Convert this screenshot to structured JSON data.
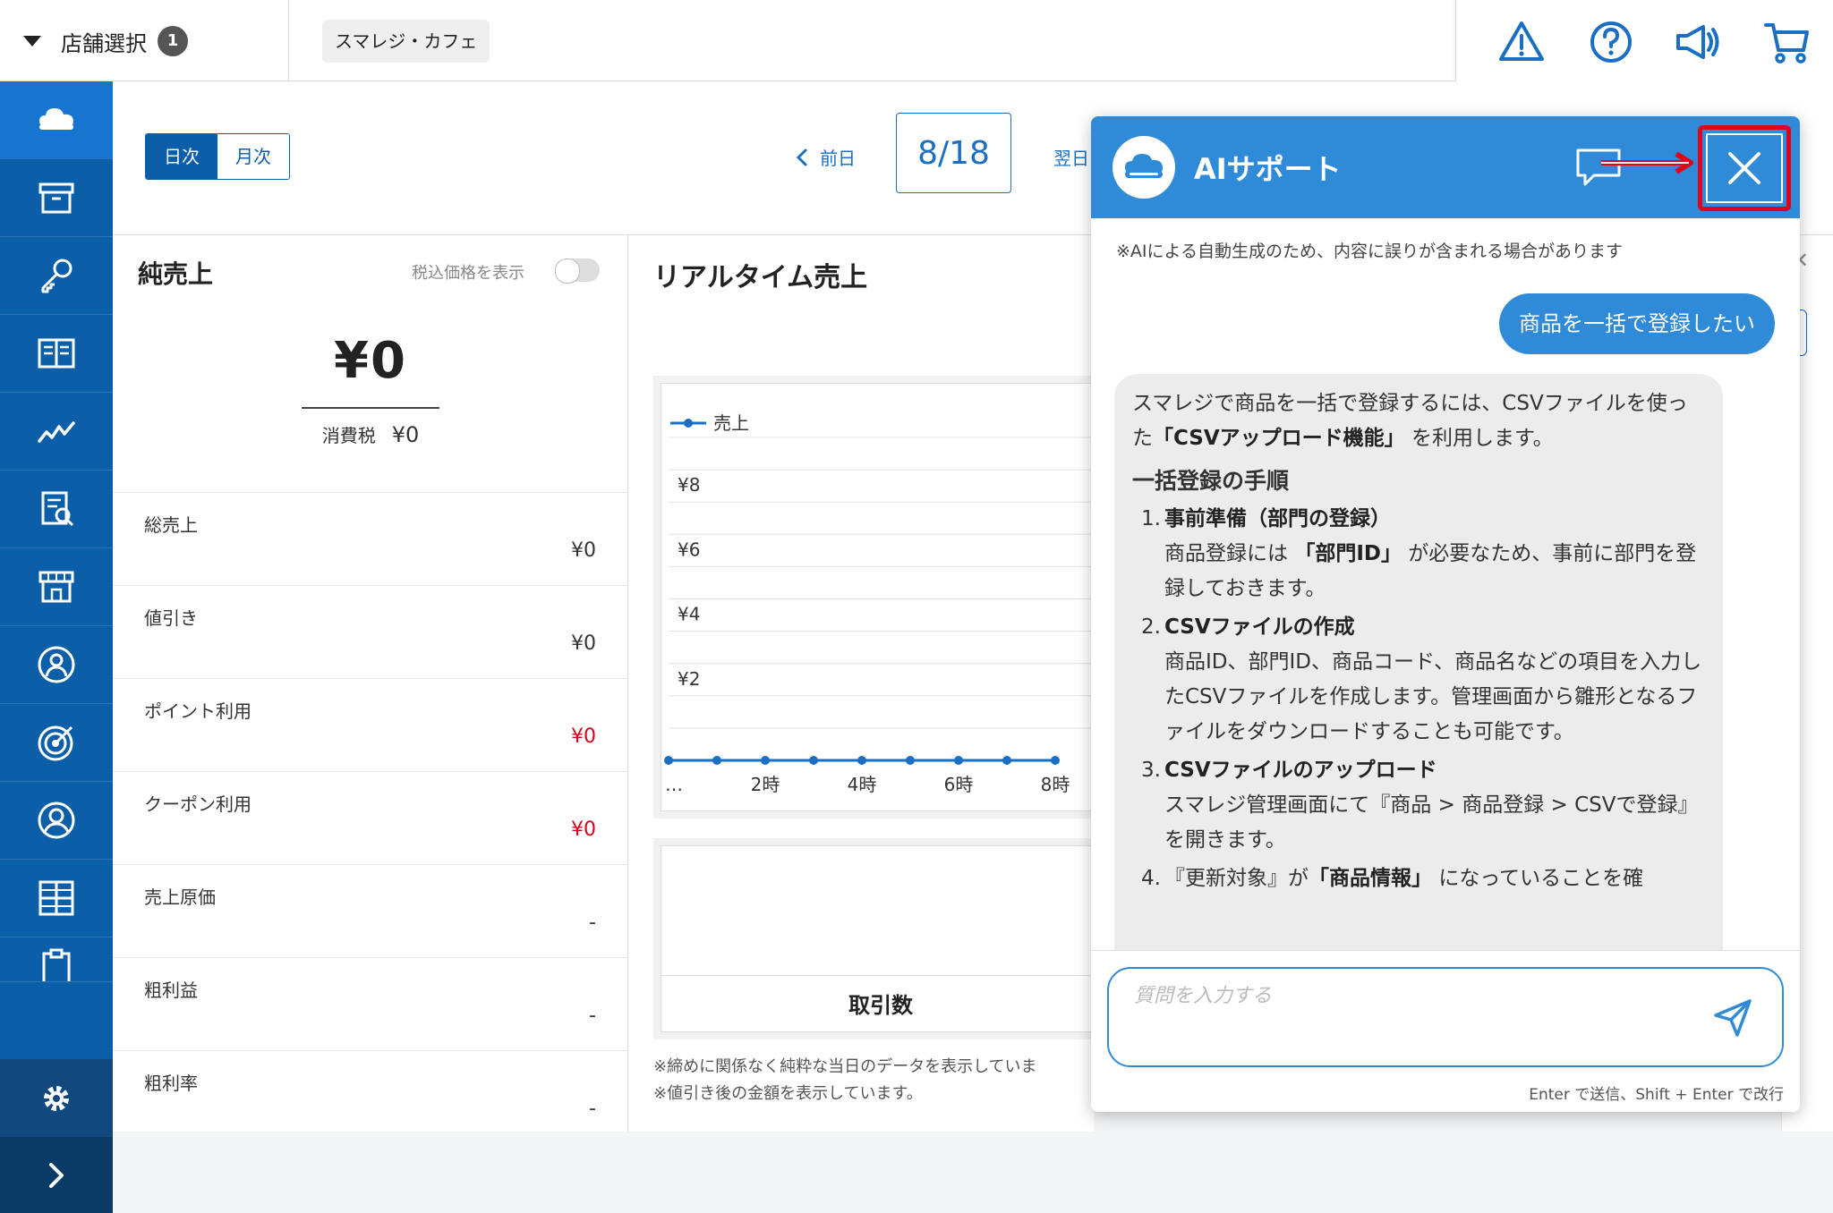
{
  "topbar": {
    "store_select_label": "店舗選択",
    "store_count": "1",
    "shop_name": "スマレジ・カフェ",
    "icons": [
      "warning-icon",
      "help-icon",
      "megaphone-icon",
      "cart-icon"
    ]
  },
  "sidebar": {
    "items": [
      "cloud-icon",
      "archive-icon",
      "key-icon",
      "book-icon",
      "trend-icon",
      "report-icon",
      "store-icon",
      "person-badge-icon",
      "target-icon",
      "user-icon",
      "grid-icon",
      "clipboard-icon"
    ],
    "bottom": [
      "gear-icon",
      "chevron-right-icon"
    ]
  },
  "header": {
    "tab_daily": "日次",
    "tab_monthly": "月次",
    "prev_label": "前日",
    "date": "8/18",
    "next_label": "翌日"
  },
  "net_sales": {
    "title": "純売上",
    "tax_toggle_label": "税込価格を表示",
    "amount": "¥0",
    "tax_label": "消費税",
    "tax_value": "¥0",
    "metrics": [
      {
        "label": "総売上",
        "value": "¥0"
      },
      {
        "label": "値引き",
        "value": "¥0"
      },
      {
        "label": "ポイント利用",
        "value": "¥0"
      },
      {
        "label": "クーポン利用",
        "value": "¥0"
      },
      {
        "label": "売上原価",
        "value": "-"
      },
      {
        "label": "粗利益",
        "value": "-"
      },
      {
        "label": "粗利率",
        "value": "-"
      }
    ]
  },
  "realtime": {
    "title": "リアルタイム売上",
    "card2_label": "取引数",
    "note1": "※締めに関係なく純粋な当日のデータを表示していま",
    "note2": "※値引き後の金額を表示しています。"
  },
  "chart_data": {
    "type": "line",
    "legend": [
      "売上"
    ],
    "x": [
      "…",
      "2時",
      "4時",
      "6時",
      "8時"
    ],
    "series": [
      {
        "name": "売上",
        "values": [
          0,
          0,
          0,
          0,
          0,
          0,
          0,
          0,
          0
        ]
      }
    ],
    "yticks": [
      "¥2",
      "¥4",
      "¥6",
      "¥8"
    ],
    "ylim": [
      0,
      10
    ],
    "color": "#1a6fc3"
  },
  "ai_panel": {
    "title": "AIサポート",
    "disclaimer": "※AIによる自動生成のため、内容に誤りが含まれる場合があります",
    "user_message": "商品を一括で登録したい",
    "ai_intro_1": "スマレジで商品を一括で登録するには、CSVファイルを使った",
    "ai_intro_bold": "「CSVアップロード機能」",
    "ai_intro_2": "を利用します。",
    "ai_heading": "一括登録の手順",
    "steps": [
      {
        "num": "1.",
        "title": "事前準備（部門の登録）",
        "text_a": "商品登録には",
        "bold": "「部門ID」",
        "text_b": "が必要なため、事前に部門を登録しておきます。"
      },
      {
        "num": "2.",
        "title": "CSVファイルの作成",
        "text_a": "商品ID、部門ID、商品コード、商品名などの項目を入力したCSVファイルを作成します。管理画面から雛形となるファイルをダウンロードすることも可能です。",
        "bold": "",
        "text_b": ""
      },
      {
        "num": "3.",
        "title": "CSVファイルのアップロード",
        "text_a": "スマレジ管理画面にて『商品 > 商品登録 > CSVで登録』を開きます。",
        "bold": "",
        "text_b": ""
      }
    ],
    "step4_a": "『更新対象』が",
    "step4_bold": "「商品情報」",
    "step4_b": "になっていることを確",
    "step4_num": "4.",
    "input_placeholder": "質問を入力する",
    "hint": "Enter で送信、Shift + Enter で改行"
  },
  "colors": {
    "primary": "#0b5ea8",
    "accent": "#2f8ad8",
    "highlight": "#e0001a",
    "negative": "#d0021b"
  }
}
